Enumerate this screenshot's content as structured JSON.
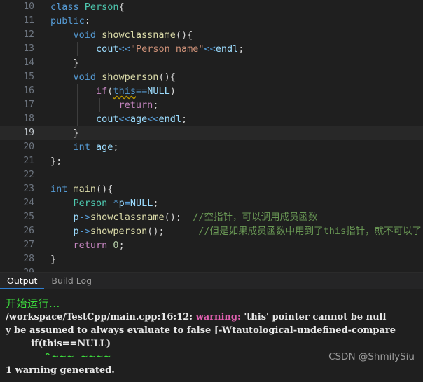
{
  "editor": {
    "language": "cpp",
    "active_line": 19,
    "lines": [
      {
        "num": "10",
        "indent_guides": 0,
        "tokens": [
          {
            "t": "class ",
            "c": "kw"
          },
          {
            "t": "Person",
            "c": "typ"
          },
          {
            "t": "{",
            "c": "punct"
          }
        ]
      },
      {
        "num": "11",
        "indent_guides": 0,
        "tokens": [
          {
            "t": "public",
            "c": "kw"
          },
          {
            "t": ":",
            "c": "punct"
          }
        ]
      },
      {
        "num": "12",
        "indent_guides": 1,
        "tokens": [
          {
            "t": "    ",
            "c": "pln"
          },
          {
            "t": "void ",
            "c": "kw"
          },
          {
            "t": "showclassname",
            "c": "fn"
          },
          {
            "t": "(){",
            "c": "punct"
          }
        ]
      },
      {
        "num": "13",
        "indent_guides": 2,
        "tokens": [
          {
            "t": "        ",
            "c": "pln"
          },
          {
            "t": "cout",
            "c": "var"
          },
          {
            "t": "<<",
            "c": "op"
          },
          {
            "t": "\"Person name\"",
            "c": "str"
          },
          {
            "t": "<<",
            "c": "op"
          },
          {
            "t": "endl",
            "c": "var"
          },
          {
            "t": ";",
            "c": "punct"
          }
        ]
      },
      {
        "num": "14",
        "indent_guides": 1,
        "tokens": [
          {
            "t": "    ",
            "c": "pln"
          },
          {
            "t": "}",
            "c": "punct"
          }
        ]
      },
      {
        "num": "15",
        "indent_guides": 1,
        "tokens": [
          {
            "t": "    ",
            "c": "pln"
          },
          {
            "t": "void ",
            "c": "kw"
          },
          {
            "t": "showperson",
            "c": "fn"
          },
          {
            "t": "(){",
            "c": "punct"
          }
        ]
      },
      {
        "num": "16",
        "indent_guides": 2,
        "tokens": [
          {
            "t": "        ",
            "c": "pln"
          },
          {
            "t": "if",
            "c": "ctl"
          },
          {
            "t": "(",
            "c": "punct"
          },
          {
            "t": "this",
            "c": "kw",
            "u": "warn"
          },
          {
            "t": "==",
            "c": "op"
          },
          {
            "t": "NULL",
            "c": "var"
          },
          {
            "t": ")",
            "c": "punct"
          }
        ]
      },
      {
        "num": "17",
        "indent_guides": 3,
        "tokens": [
          {
            "t": "            ",
            "c": "pln"
          },
          {
            "t": "return",
            "c": "ctl"
          },
          {
            "t": ";",
            "c": "punct"
          }
        ]
      },
      {
        "num": "18",
        "indent_guides": 2,
        "tokens": [
          {
            "t": "        ",
            "c": "pln"
          },
          {
            "t": "cout",
            "c": "var"
          },
          {
            "t": "<<",
            "c": "op"
          },
          {
            "t": "age",
            "c": "var"
          },
          {
            "t": "<<",
            "c": "op"
          },
          {
            "t": "endl",
            "c": "var"
          },
          {
            "t": ";",
            "c": "punct"
          }
        ]
      },
      {
        "num": "19",
        "indent_guides": 1,
        "active": true,
        "tokens": [
          {
            "t": "    ",
            "c": "pln"
          },
          {
            "t": "}",
            "c": "punct"
          }
        ]
      },
      {
        "num": "20",
        "indent_guides": 1,
        "tokens": [
          {
            "t": "    ",
            "c": "pln"
          },
          {
            "t": "int ",
            "c": "kw"
          },
          {
            "t": "age",
            "c": "var"
          },
          {
            "t": ";",
            "c": "punct"
          }
        ]
      },
      {
        "num": "21",
        "indent_guides": 0,
        "tokens": [
          {
            "t": "};",
            "c": "punct"
          }
        ]
      },
      {
        "num": "22",
        "indent_guides": 0,
        "tokens": []
      },
      {
        "num": "23",
        "indent_guides": 0,
        "tokens": [
          {
            "t": "int ",
            "c": "kw"
          },
          {
            "t": "main",
            "c": "fn"
          },
          {
            "t": "(){",
            "c": "punct"
          }
        ]
      },
      {
        "num": "24",
        "indent_guides": 1,
        "tokens": [
          {
            "t": "    ",
            "c": "pln"
          },
          {
            "t": "Person ",
            "c": "typ"
          },
          {
            "t": "*",
            "c": "op"
          },
          {
            "t": "p",
            "c": "var"
          },
          {
            "t": "=",
            "c": "op"
          },
          {
            "t": "NULL",
            "c": "var"
          },
          {
            "t": ";",
            "c": "punct"
          }
        ]
      },
      {
        "num": "25",
        "indent_guides": 1,
        "tokens": [
          {
            "t": "    ",
            "c": "pln"
          },
          {
            "t": "p",
            "c": "var"
          },
          {
            "t": "->",
            "c": "op"
          },
          {
            "t": "showclassname",
            "c": "fn"
          },
          {
            "t": "();  ",
            "c": "punct"
          },
          {
            "t": "//空指针，可以调用成员函数",
            "c": "cmt"
          }
        ]
      },
      {
        "num": "26",
        "indent_guides": 1,
        "tokens": [
          {
            "t": "    ",
            "c": "pln"
          },
          {
            "t": "p",
            "c": "var"
          },
          {
            "t": "->",
            "c": "op"
          },
          {
            "t": "showperson",
            "c": "fn",
            "u": "info"
          },
          {
            "t": "();      ",
            "c": "punct"
          },
          {
            "t": "//但是如果成员函数中用到了this指针，就不可以了",
            "c": "cmt"
          }
        ]
      },
      {
        "num": "27",
        "indent_guides": 1,
        "tokens": [
          {
            "t": "    ",
            "c": "pln"
          },
          {
            "t": "return ",
            "c": "ctl"
          },
          {
            "t": "0",
            "c": "num"
          },
          {
            "t": ";",
            "c": "punct"
          }
        ]
      },
      {
        "num": "28",
        "indent_guides": 0,
        "tokens": [
          {
            "t": "}",
            "c": "punct"
          }
        ]
      },
      {
        "num": "29",
        "indent_guides": 0,
        "clipped": true,
        "tokens": []
      }
    ]
  },
  "panel": {
    "tabs": [
      {
        "label": "Output",
        "active": true
      },
      {
        "label": "Build Log",
        "active": false
      }
    ],
    "run_status": "开始运行...",
    "output_lines": [
      {
        "segments": [
          {
            "t": "/workspace/TestCpp/main.cpp:16:12: ",
            "c": "plain"
          },
          {
            "t": "warning: ",
            "c": "warn"
          },
          {
            "t": "'this' pointer cannot be null",
            "c": "plain"
          }
        ]
      },
      {
        "segments": [
          {
            "t": "y be assumed to always evaluate to false [-Wtautological-undefined-compare",
            "c": "plain"
          }
        ]
      },
      {
        "segments": [
          {
            "t": "        if(this==NULL)",
            "c": "plain"
          }
        ]
      },
      {
        "segments": [
          {
            "t": "            ",
            "c": "plain"
          },
          {
            "t": "^~~~  ~~~~",
            "c": "squiggle"
          }
        ]
      },
      {
        "segments": [
          {
            "t": "1 warning generated.",
            "c": "plain"
          }
        ]
      }
    ],
    "watermark": "CSDN @ShmilySiu"
  }
}
